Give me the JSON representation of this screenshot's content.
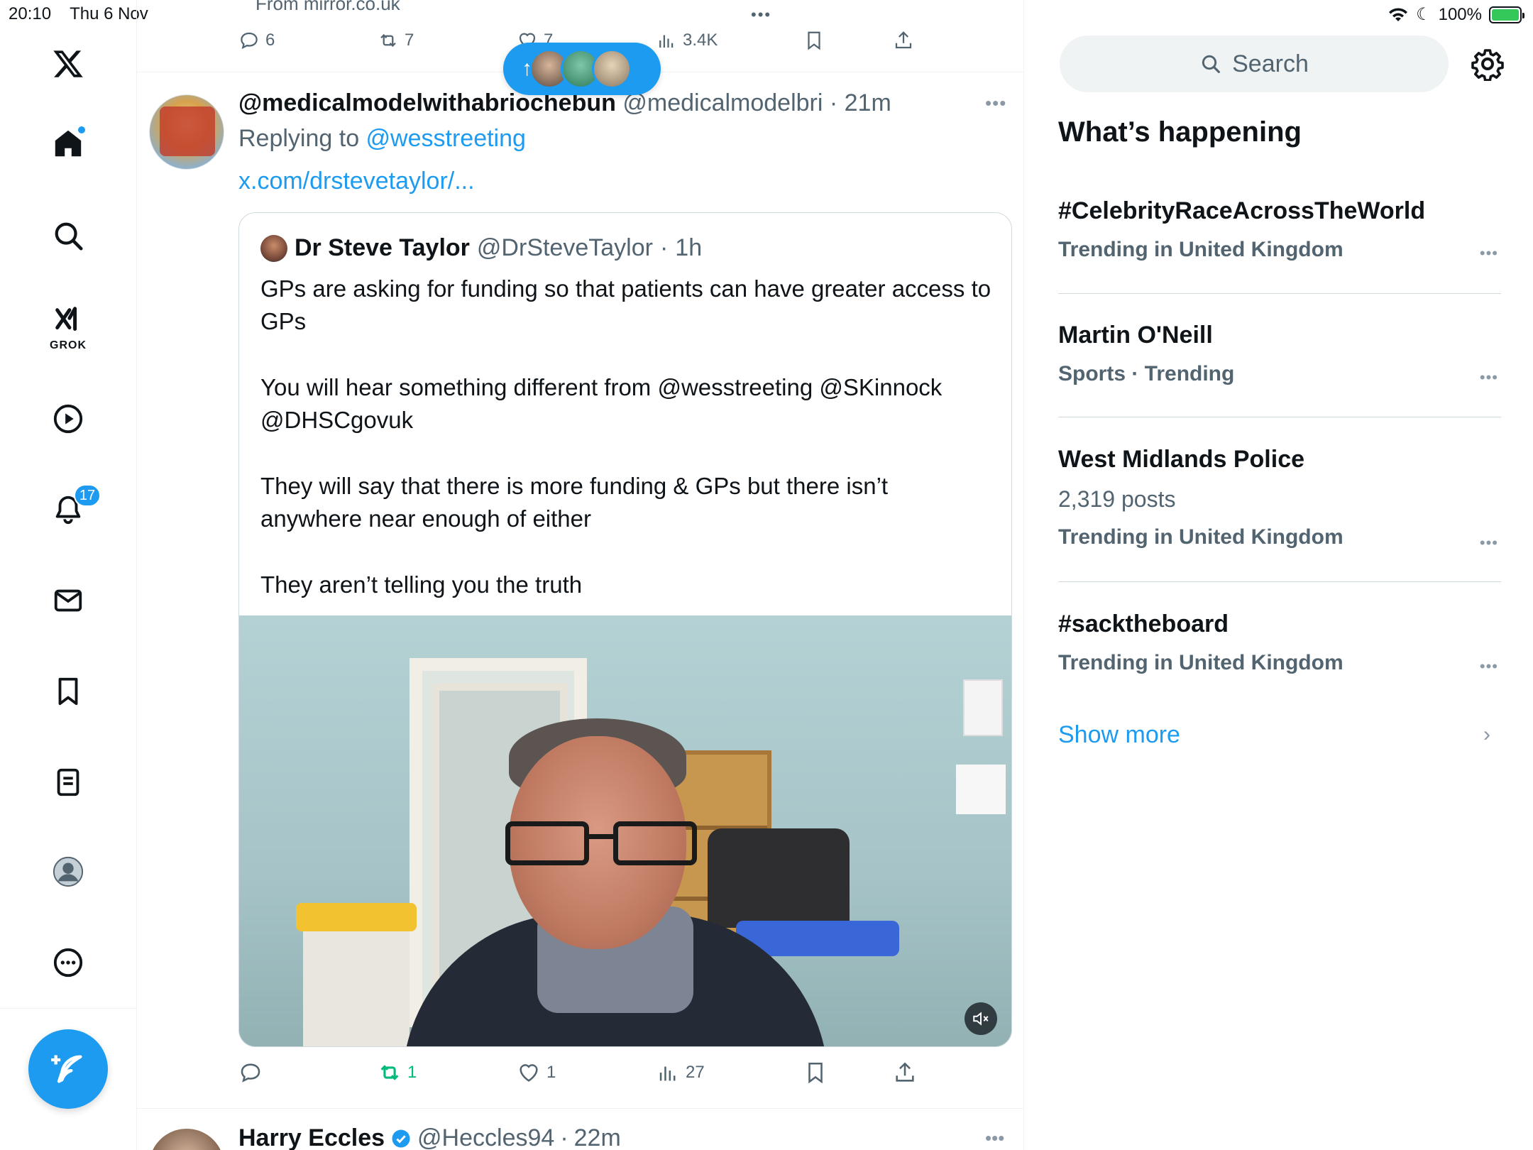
{
  "status_bar": {
    "time": "20:10",
    "date": "Thu 6 Nov",
    "battery": "100%"
  },
  "nav": {
    "grok_label": "GROK",
    "notifications_count": "17"
  },
  "previous_post": {
    "source": "From mirror.co.uk",
    "replies": "6",
    "reposts": "7",
    "likes": "7",
    "views": "3.4K"
  },
  "tweet": {
    "name": "@medicalmodelwithabriochebun",
    "handle": "@medicalmodelbri",
    "time": "21m",
    "replying_prefix": "Replying to ",
    "replying_to": "@wesstreeting",
    "link": "x.com/drstevetaylor/...",
    "quote": {
      "name": "Dr Steve Taylor",
      "handle": "@DrSteveTaylor",
      "time": "1h",
      "paragraphs": [
        "GPs are asking for funding so that patients can have greater access to GPs",
        "You will hear something different from @wesstreeting @SKinnock @DHSCgovuk",
        "They will say that there is more funding & GPs but there isn’t anywhere near enough of either",
        "They aren’t telling you the truth"
      ]
    },
    "actions": {
      "replies": "",
      "reposts": "1",
      "likes": "1",
      "views": "27"
    }
  },
  "next_tweet": {
    "name": "Harry Eccles",
    "handle": "@Heccles94",
    "time": "22m"
  },
  "sidebar": {
    "search_placeholder": "Search",
    "section_title": "What’s happening",
    "trends": [
      {
        "title": "#CelebrityRaceAcrossTheWorld",
        "meta": "Trending in United Kingdom"
      },
      {
        "title": "Martin O'Neill",
        "meta": "Sports · Trending"
      },
      {
        "title": "West Midlands Police",
        "posts": "2,319 posts",
        "meta": "Trending in United Kingdom"
      },
      {
        "title": "#sacktheboard",
        "meta": "Trending in United Kingdom"
      }
    ],
    "show_more": "Show more"
  },
  "colors": {
    "accent": "#1d9bf0",
    "repost_green": "#00ba7c",
    "text": "#0f1419",
    "muted": "#536471"
  }
}
